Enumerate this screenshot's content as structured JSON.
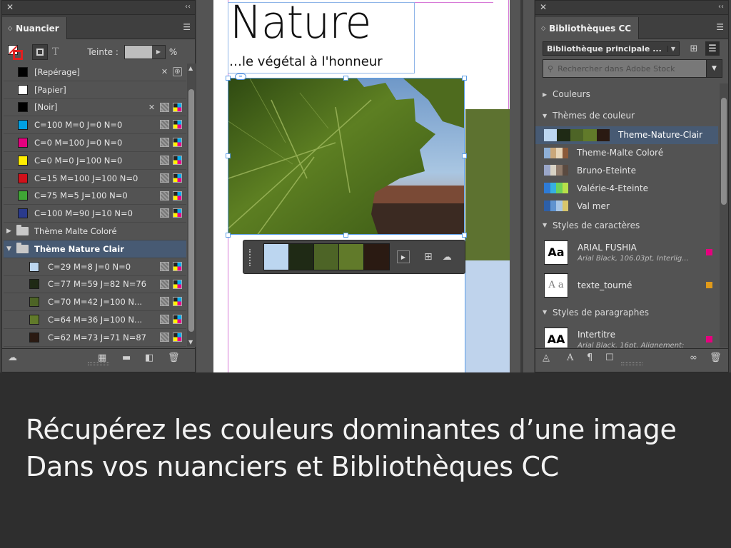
{
  "swatches_panel": {
    "tab_label": "Nuancier",
    "tint_label": "Teinte :",
    "tint_value": "",
    "tint_unit": "%",
    "rows": [
      {
        "name": "[Repérage]",
        "color": "#000000",
        "kind": "registration"
      },
      {
        "name": "[Papier]",
        "color": "#ffffff",
        "kind": "paper"
      },
      {
        "name": "[Noir]",
        "color": "#000000",
        "kind": "black"
      },
      {
        "name": "C=100 M=0 J=0 N=0",
        "color": "#00a0e3"
      },
      {
        "name": "C=0 M=100 J=0 N=0",
        "color": "#e5007e"
      },
      {
        "name": "C=0 M=0 J=100 N=0",
        "color": "#ffed00"
      },
      {
        "name": "C=15 M=100 J=100 N=0",
        "color": "#d0111b"
      },
      {
        "name": "C=75 M=5 J=100 N=0",
        "color": "#3fa535"
      },
      {
        "name": "C=100 M=90 J=10 N=0",
        "color": "#2a3a8c"
      },
      {
        "name": "Thème Malte Coloré",
        "kind": "group",
        "expanded": false
      },
      {
        "name": "Thème Nature Clair",
        "kind": "group",
        "expanded": true,
        "selected": true
      },
      {
        "name": "C=29 M=8 J=0 N=0",
        "color": "#bcd6f0",
        "indent": true
      },
      {
        "name": "C=77 M=59 J=82 N=76",
        "color": "#1f2a15",
        "indent": true
      },
      {
        "name": "C=70 M=42 J=100 N...",
        "color": "#4d6426",
        "indent": true
      },
      {
        "name": "C=64 M=36 J=100 N...",
        "color": "#617a2a",
        "indent": true
      },
      {
        "name": "C=62 M=73 J=71 N=87",
        "color": "#2a1a12",
        "indent": true
      }
    ]
  },
  "document": {
    "title": "Nature",
    "subtitle": "…le végétal à l'honneur",
    "theme_colors": [
      "#bcd6f0",
      "#1f2a15",
      "#4d6426",
      "#617a2a",
      "#2a1a12"
    ]
  },
  "libraries_panel": {
    "tab_label": "Bibliothèques CC",
    "library_name": "Bibliothèque principale ...",
    "search_placeholder": "Rechercher dans Adobe Stock",
    "section_colors": "Couleurs",
    "section_themes": "Thèmes de couleur",
    "themes": [
      {
        "name": "Theme-Nature-Clair",
        "selected": true,
        "colors": [
          "#bcd6f0",
          "#1f2a15",
          "#4d6426",
          "#617a2a",
          "#2a1a12"
        ]
      },
      {
        "name": "Theme-Malte Coloré",
        "colors": [
          "#8fb0d6",
          "#c9a77a",
          "#e6d5b8",
          "#8a5a3a"
        ]
      },
      {
        "name": "Bruno-Eteinte",
        "colors": [
          "#9aa6c8",
          "#d8d2c4",
          "#8f7a6a",
          "#5a4a40"
        ]
      },
      {
        "name": "Valérie-4-Eteinte",
        "colors": [
          "#2e7bd6",
          "#37b0e0",
          "#6fd15a",
          "#b8e04a"
        ]
      },
      {
        "name": "Val mer",
        "colors": [
          "#2d5fa8",
          "#5f93cf",
          "#a7c6e6",
          "#d8c56a"
        ]
      }
    ],
    "section_char_styles": "Styles de caractères",
    "char_styles": [
      {
        "thumb": "Aa",
        "name": "ARIAL FUSHIA",
        "desc": "Arial Black, 106.03pt, Interlig...",
        "dot": "#e5007e"
      },
      {
        "thumb": "A a",
        "name": "texte_tourné",
        "desc": "",
        "dot": "#e09a1a"
      }
    ],
    "section_para_styles": "Styles de paragraphes",
    "para_styles": [
      {
        "thumb": "AA",
        "name": "Intertitre",
        "desc": "Arial Black, 16pt, Alignement:",
        "dot": "#e5007e"
      }
    ]
  },
  "caption": {
    "line1": "Récupérez les couleurs dominantes d’une image",
    "line2": "Dans vos nuanciers et Bibliothèques CC"
  }
}
